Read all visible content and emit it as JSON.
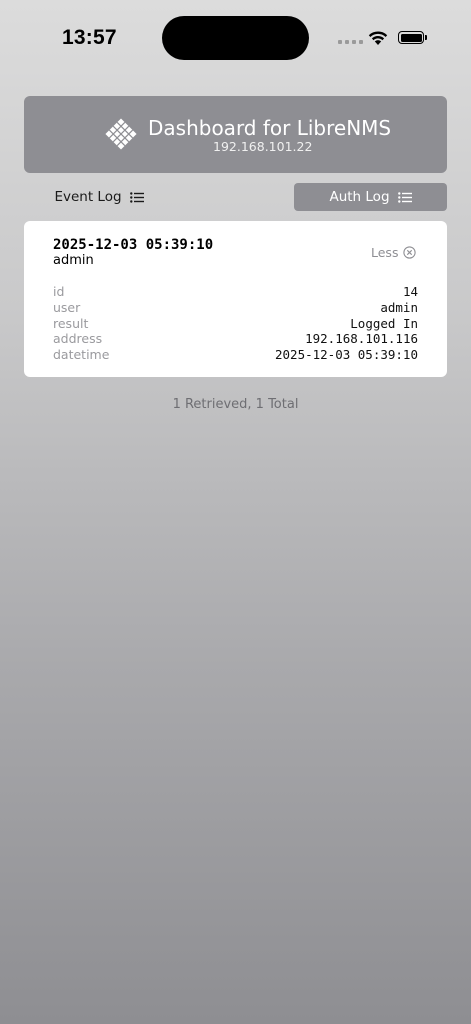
{
  "status_bar": {
    "time": "13:57",
    "icons": [
      "cellular-signal-icon",
      "wifi-icon",
      "battery-icon"
    ]
  },
  "header": {
    "title": "Dashboard for LibreNMS",
    "subtitle": "192.168.101.22",
    "logo": "librenms-logo"
  },
  "tabs": [
    {
      "label": "Event Log",
      "icon": "list-icon",
      "selected": false
    },
    {
      "label": "Auth Log",
      "icon": "list-icon",
      "selected": true
    }
  ],
  "entry": {
    "datetime_heading": "2025-12-03 05:39:10",
    "user_heading": "admin",
    "toggle_label": "Less",
    "toggle_icon": "close-circle-icon",
    "fields": [
      {
        "key": "id",
        "value": "14"
      },
      {
        "key": "user",
        "value": "admin"
      },
      {
        "key": "result",
        "value": "Logged In"
      },
      {
        "key": "address",
        "value": "192.168.101.116"
      },
      {
        "key": "datetime",
        "value": "2025-12-03 05:39:10"
      }
    ]
  },
  "footer": {
    "summary": "1 Retrieved, 1 Total"
  },
  "colors": {
    "accent_gray": "#8e8e93",
    "card_background": "#ffffff"
  }
}
